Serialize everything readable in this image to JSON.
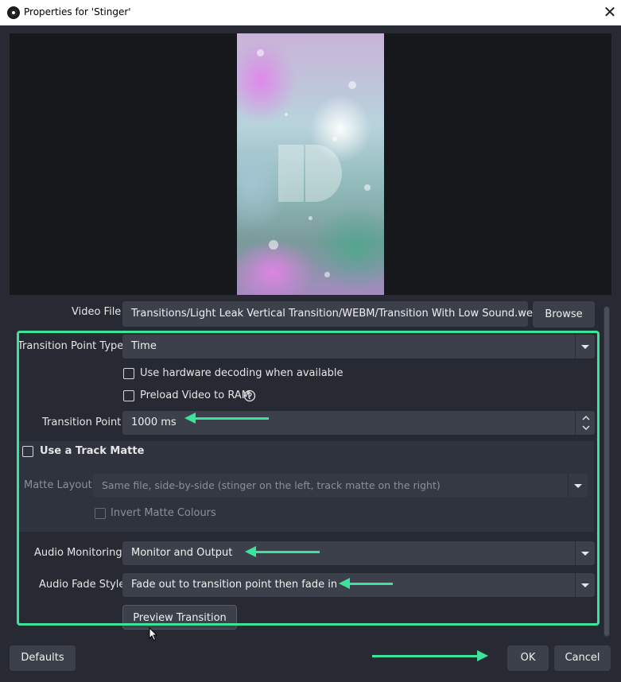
{
  "window": {
    "title": "Properties for 'Stinger'"
  },
  "form": {
    "video_file": {
      "label": "Video File",
      "value": "Transitions/Light Leak Vertical Transition/WEBM/Transition With Low Sound.webm",
      "browse_label": "Browse"
    },
    "transition_point_type": {
      "label": "Transition Point Type",
      "value": "Time"
    },
    "hw_decoding": {
      "label": "Use hardware decoding when available",
      "checked": false
    },
    "preload_ram": {
      "label": "Preload Video to RAM",
      "checked": false
    },
    "transition_point": {
      "label": "Transition Point",
      "value": "1000 ms"
    },
    "track_matte": {
      "label": "Use a Track Matte",
      "checked": false
    },
    "matte_layout": {
      "label": "Matte Layout",
      "value": "Same file, side-by-side (stinger on the left, track matte on the right)"
    },
    "invert_matte": {
      "label": "Invert Matte Colours",
      "checked": false
    },
    "audio_monitoring": {
      "label": "Audio Monitoring",
      "value": "Monitor and Output"
    },
    "audio_fade_style": {
      "label": "Audio Fade Style",
      "value": "Fade out to transition point then fade in"
    },
    "preview_label": "Preview Transition"
  },
  "footer": {
    "defaults_label": "Defaults",
    "ok_label": "OK",
    "cancel_label": "Cancel"
  },
  "colors": {
    "highlight": "#3de39a",
    "background": "#272a33",
    "field": "#3c404b"
  },
  "icons": {
    "help": "help-circle-icon",
    "close": "close-icon",
    "app": "obs-icon"
  }
}
